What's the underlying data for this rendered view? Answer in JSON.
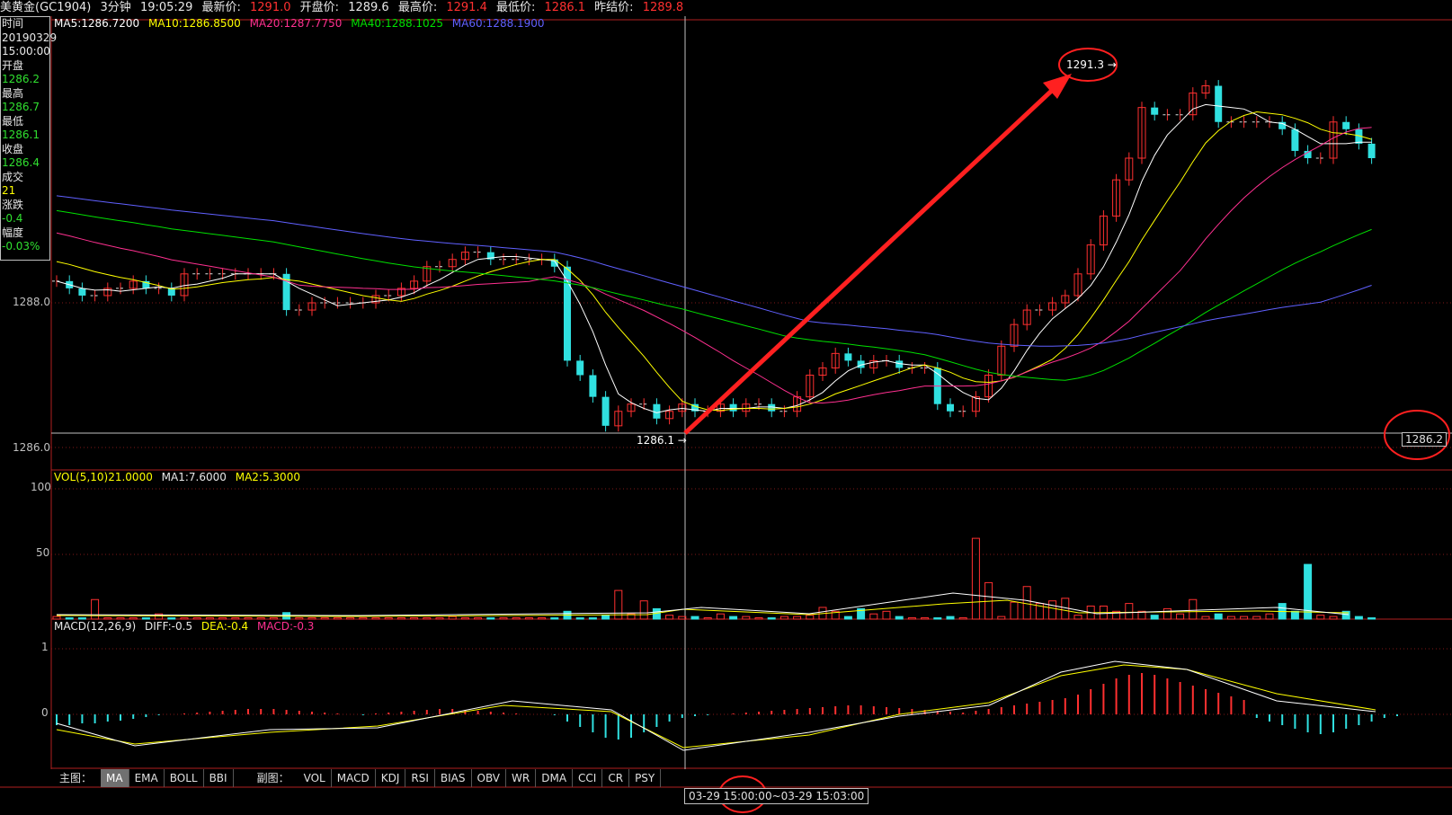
{
  "header": {
    "symbol": "美黄金(GC1904)",
    "period": "3分钟",
    "time": "19:05:29",
    "latest_label": "最新价:",
    "latest_value": "1291.0",
    "open_label": "开盘价:",
    "open_value": "1289.6",
    "high_label": "最高价:",
    "high_value": "1291.4",
    "low_label": "最低价:",
    "low_value": "1286.1",
    "prev_label": "昨结价:",
    "prev_value": "1289.8"
  },
  "infobox": {
    "time_label": "时间",
    "date": "20190329",
    "time": "15:00:00",
    "open_label": "开盘",
    "open": "1286.2",
    "high_label": "最高",
    "high": "1286.7",
    "low_label": "最低",
    "low": "1286.1",
    "close_label": "收盘",
    "close": "1286.4",
    "vol_label": "成交",
    "vol": "21",
    "chg_label": "涨跌",
    "chg": "-0.4",
    "pct_label": "幅度",
    "pct": "-0.03%"
  },
  "ma_legend": {
    "ma5": "MA5:1286.7200",
    "ma10": "MA10:1286.8500",
    "ma20": "MA20:1287.7750",
    "ma40": "MA40:1288.1025",
    "ma60": "MA60:1288.1900"
  },
  "vol_legend": {
    "vol": "VOL(5,10)21.0000",
    "ma1": "MA1:7.6000",
    "ma2": "MA2:5.3000"
  },
  "macd_legend": {
    "macd": "MACD(12,26,9)",
    "diff": "DIFF:-0.5",
    "dea": "DEA:-0.4",
    "macdv": "MACD:-0.3"
  },
  "axis": {
    "p1288": "1288.0",
    "p1286": "1286.0",
    "v100": "100",
    "v50": "50",
    "m1": "1",
    "m0": "0"
  },
  "annotations": {
    "high_mark": "1291.3",
    "low_mark": "1286.1",
    "cursor_price": "1286.2"
  },
  "tabs": {
    "main_label": "主图：",
    "main": [
      "MA",
      "EMA",
      "BOLL",
      "BBI"
    ],
    "sub_label": "副图：",
    "sub": [
      "VOL",
      "MACD",
      "KDJ",
      "RSI",
      "BIAS",
      "OBV",
      "WR",
      "DMA",
      "CCI",
      "CR",
      "PSY"
    ]
  },
  "timebar": {
    "text": "03-29 15:00:00~03-29 15:03:00"
  },
  "colors": {
    "up": "#ff3030",
    "down": "#30e0e0",
    "ma5": "#ffffff",
    "ma10": "#ffff00",
    "ma20": "#ff3090",
    "ma40": "#00e000",
    "ma60": "#6060ff"
  }
}
